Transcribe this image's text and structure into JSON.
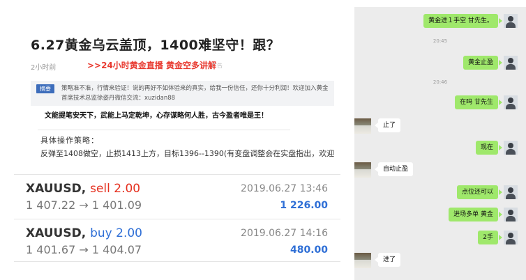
{
  "article": {
    "title": "6.27黄金乌云盖顶，1400难坚守！跟？",
    "time": "2小时前",
    "promo_link": ">>24小时黄金直播 黄金空多讲解",
    "ad_label": "广告",
    "summary_tag": "摘要",
    "summary_text": "策略准不准，行情来验证！说的再好不如体验来的真实，给我一份信任，还你十分利润！欢迎加入黄金首席技术总监徐姿丹微信交流：xuzidan88",
    "slogan": "文能提笔安天下，武能上马定乾坤，心存谋略何人胜，古今盈者唯是王！",
    "strategy_label": "具体操作策略：",
    "strategy_text": "反弹至1408做空，止损1413上方，目标1396--1390(有变盘调整会在实盘指出，欢迎"
  },
  "trades": [
    {
      "symbol": "XAUUSD",
      "side": "sell 2.00",
      "prices": "1 407.22 → 1 401.09",
      "date": "2019.06.27 13:46",
      "profit": "1 226.00"
    },
    {
      "symbol": "XAUUSD",
      "side": "buy 2.00",
      "prices": "1 401.67 → 1 404.07",
      "date": "2019.06.27 14:16",
      "profit": "480.00"
    }
  ],
  "chat": {
    "messages": [
      {
        "text": "黄金进１手空 甘先生。",
        "from": "me"
      },
      {
        "text": "20:45",
        "from": "time"
      },
      {
        "text": "黄金止盈",
        "from": "me"
      },
      {
        "text": "20:46",
        "from": "time"
      },
      {
        "text": "在吗 甘先生",
        "from": "me"
      },
      {
        "text": "止了",
        "from": "other"
      },
      {
        "text": "现在",
        "from": "me"
      },
      {
        "text": "自动止盈",
        "from": "other"
      },
      {
        "text": "点位还可以",
        "from": "me"
      },
      {
        "text": "进场多单 黄金",
        "from": "me"
      },
      {
        "text": "2手",
        "from": "me"
      },
      {
        "text": "进了",
        "from": "other"
      }
    ]
  },
  "colors": {
    "sell": "#e5301f",
    "buy": "#2f6fd6",
    "bubble_me": "#9fe86b",
    "link": "#e8392f"
  }
}
